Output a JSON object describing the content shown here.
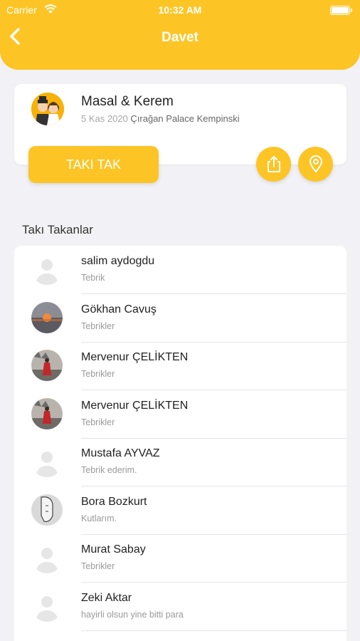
{
  "status_bar": {
    "carrier": "Carrier",
    "time": "10:32 AM"
  },
  "nav": {
    "title": "Davet"
  },
  "event": {
    "names": "Masal & Kerem",
    "date": "5 Kas 2020",
    "place": "Çırağan Palace Kempinski"
  },
  "actions": {
    "taki_tak": "TAKI TAK"
  },
  "section": {
    "title": "Takı Takanlar"
  },
  "guests": [
    {
      "name": "salim aydogdu",
      "message": "Tebrik",
      "avatar": "placeholder"
    },
    {
      "name": "Gökhan Cavuş",
      "message": "Tebrikler",
      "avatar": "sunset"
    },
    {
      "name": "Mervenur ÇELİKTEN",
      "message": "Tebrikler",
      "avatar": "photo-red"
    },
    {
      "name": "Mervenur ÇELİKTEN",
      "message": "Tebrikler",
      "avatar": "photo-red"
    },
    {
      "name": "Mustafa AYVAZ",
      "message": "Tebrik ederim.",
      "avatar": "placeholder"
    },
    {
      "name": "Bora Bozkurt",
      "message": "Kutlarım.",
      "avatar": "sketch"
    },
    {
      "name": "Murat Sabay",
      "message": "Tebrikler",
      "avatar": "placeholder"
    },
    {
      "name": "Zeki Aktar",
      "message": "hayirli olsun yine bitti para",
      "avatar": "placeholder"
    }
  ],
  "colors": {
    "accent": "#fcc525",
    "background": "#f2f2f6"
  }
}
